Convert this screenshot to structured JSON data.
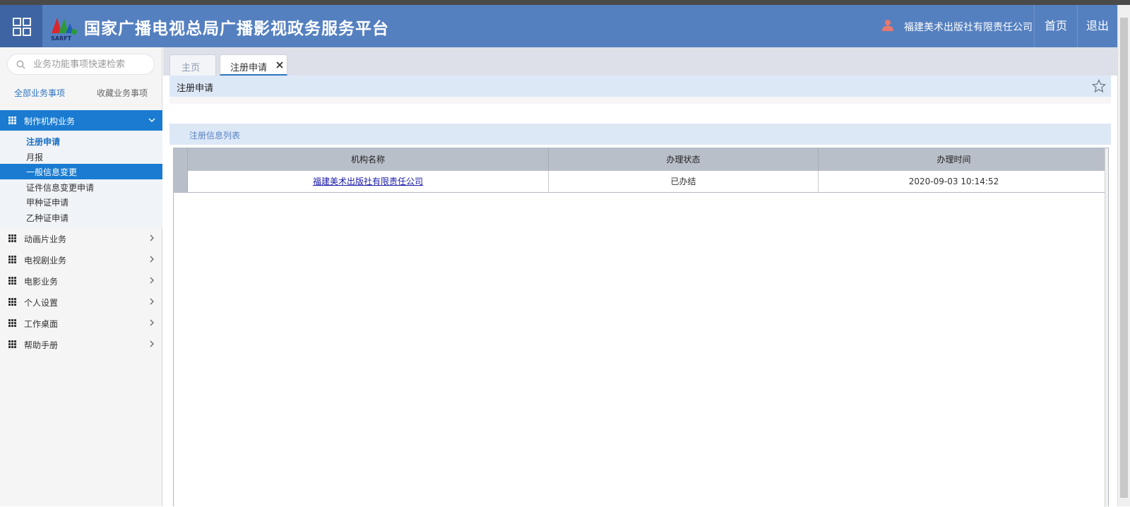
{
  "header": {
    "site_title": "国家广播电视总局广播影视政务服务平台",
    "logo_text": "SARFT",
    "user_name": "福建美术出版社有限责任公司",
    "home_label": "首页",
    "logout_label": "退出",
    "accent_color": "#5580c0"
  },
  "sidebar": {
    "search_placeholder": "业务功能事项快速检索",
    "tabs": {
      "all": "全部业务事项",
      "favorites": "收藏业务事项"
    },
    "groups": [
      {
        "label": "制作机构业务",
        "expanded": true
      },
      {
        "label": "动画片业务"
      },
      {
        "label": "电视剧业务"
      },
      {
        "label": "电影业务"
      },
      {
        "label": "个人设置"
      },
      {
        "label": "工作桌面"
      },
      {
        "label": "帮助手册"
      }
    ],
    "subitems": [
      {
        "label": "注册申请",
        "current": true
      },
      {
        "label": "月报"
      },
      {
        "label": "一般信息变更",
        "highlighted": true
      },
      {
        "label": "证件信息变更申请"
      },
      {
        "label": "甲种证申请"
      },
      {
        "label": "乙种证申请"
      }
    ]
  },
  "tabs": {
    "home": "主页",
    "active": "注册申请"
  },
  "page": {
    "title": "注册申请",
    "section_title": "注册信息列表"
  },
  "table": {
    "columns": [
      "机构名称",
      "办理状态",
      "办理时间"
    ],
    "rows": [
      {
        "org": "福建美术出版社有限责任公司",
        "status": "已办结",
        "time": "2020-09-03 10:14:52"
      }
    ]
  }
}
